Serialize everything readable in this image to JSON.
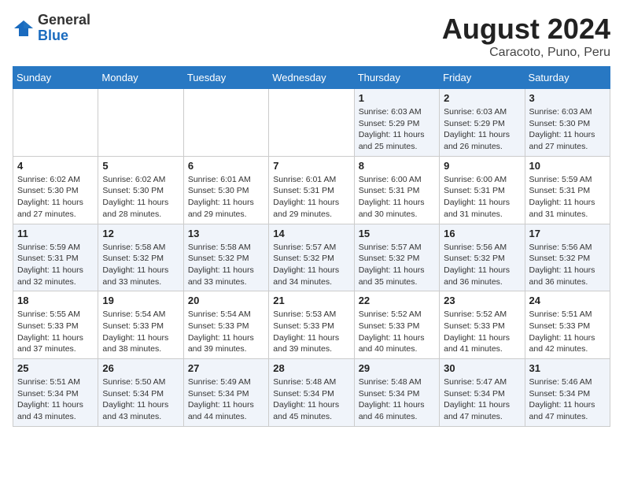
{
  "header": {
    "logo_general": "General",
    "logo_blue": "Blue",
    "title": "August 2024",
    "location": "Caracoto, Puno, Peru"
  },
  "weekdays": [
    "Sunday",
    "Monday",
    "Tuesday",
    "Wednesday",
    "Thursday",
    "Friday",
    "Saturday"
  ],
  "weeks": [
    [
      {
        "day": "",
        "info": ""
      },
      {
        "day": "",
        "info": ""
      },
      {
        "day": "",
        "info": ""
      },
      {
        "day": "",
        "info": ""
      },
      {
        "day": "1",
        "info": "Sunrise: 6:03 AM\nSunset: 5:29 PM\nDaylight: 11 hours and 25 minutes."
      },
      {
        "day": "2",
        "info": "Sunrise: 6:03 AM\nSunset: 5:29 PM\nDaylight: 11 hours and 26 minutes."
      },
      {
        "day": "3",
        "info": "Sunrise: 6:03 AM\nSunset: 5:30 PM\nDaylight: 11 hours and 27 minutes."
      }
    ],
    [
      {
        "day": "4",
        "info": "Sunrise: 6:02 AM\nSunset: 5:30 PM\nDaylight: 11 hours and 27 minutes."
      },
      {
        "day": "5",
        "info": "Sunrise: 6:02 AM\nSunset: 5:30 PM\nDaylight: 11 hours and 28 minutes."
      },
      {
        "day": "6",
        "info": "Sunrise: 6:01 AM\nSunset: 5:30 PM\nDaylight: 11 hours and 29 minutes."
      },
      {
        "day": "7",
        "info": "Sunrise: 6:01 AM\nSunset: 5:31 PM\nDaylight: 11 hours and 29 minutes."
      },
      {
        "day": "8",
        "info": "Sunrise: 6:00 AM\nSunset: 5:31 PM\nDaylight: 11 hours and 30 minutes."
      },
      {
        "day": "9",
        "info": "Sunrise: 6:00 AM\nSunset: 5:31 PM\nDaylight: 11 hours and 31 minutes."
      },
      {
        "day": "10",
        "info": "Sunrise: 5:59 AM\nSunset: 5:31 PM\nDaylight: 11 hours and 31 minutes."
      }
    ],
    [
      {
        "day": "11",
        "info": "Sunrise: 5:59 AM\nSunset: 5:31 PM\nDaylight: 11 hours and 32 minutes."
      },
      {
        "day": "12",
        "info": "Sunrise: 5:58 AM\nSunset: 5:32 PM\nDaylight: 11 hours and 33 minutes."
      },
      {
        "day": "13",
        "info": "Sunrise: 5:58 AM\nSunset: 5:32 PM\nDaylight: 11 hours and 33 minutes."
      },
      {
        "day": "14",
        "info": "Sunrise: 5:57 AM\nSunset: 5:32 PM\nDaylight: 11 hours and 34 minutes."
      },
      {
        "day": "15",
        "info": "Sunrise: 5:57 AM\nSunset: 5:32 PM\nDaylight: 11 hours and 35 minutes."
      },
      {
        "day": "16",
        "info": "Sunrise: 5:56 AM\nSunset: 5:32 PM\nDaylight: 11 hours and 36 minutes."
      },
      {
        "day": "17",
        "info": "Sunrise: 5:56 AM\nSunset: 5:32 PM\nDaylight: 11 hours and 36 minutes."
      }
    ],
    [
      {
        "day": "18",
        "info": "Sunrise: 5:55 AM\nSunset: 5:33 PM\nDaylight: 11 hours and 37 minutes."
      },
      {
        "day": "19",
        "info": "Sunrise: 5:54 AM\nSunset: 5:33 PM\nDaylight: 11 hours and 38 minutes."
      },
      {
        "day": "20",
        "info": "Sunrise: 5:54 AM\nSunset: 5:33 PM\nDaylight: 11 hours and 39 minutes."
      },
      {
        "day": "21",
        "info": "Sunrise: 5:53 AM\nSunset: 5:33 PM\nDaylight: 11 hours and 39 minutes."
      },
      {
        "day": "22",
        "info": "Sunrise: 5:52 AM\nSunset: 5:33 PM\nDaylight: 11 hours and 40 minutes."
      },
      {
        "day": "23",
        "info": "Sunrise: 5:52 AM\nSunset: 5:33 PM\nDaylight: 11 hours and 41 minutes."
      },
      {
        "day": "24",
        "info": "Sunrise: 5:51 AM\nSunset: 5:33 PM\nDaylight: 11 hours and 42 minutes."
      }
    ],
    [
      {
        "day": "25",
        "info": "Sunrise: 5:51 AM\nSunset: 5:34 PM\nDaylight: 11 hours and 43 minutes."
      },
      {
        "day": "26",
        "info": "Sunrise: 5:50 AM\nSunset: 5:34 PM\nDaylight: 11 hours and 43 minutes."
      },
      {
        "day": "27",
        "info": "Sunrise: 5:49 AM\nSunset: 5:34 PM\nDaylight: 11 hours and 44 minutes."
      },
      {
        "day": "28",
        "info": "Sunrise: 5:48 AM\nSunset: 5:34 PM\nDaylight: 11 hours and 45 minutes."
      },
      {
        "day": "29",
        "info": "Sunrise: 5:48 AM\nSunset: 5:34 PM\nDaylight: 11 hours and 46 minutes."
      },
      {
        "day": "30",
        "info": "Sunrise: 5:47 AM\nSunset: 5:34 PM\nDaylight: 11 hours and 47 minutes."
      },
      {
        "day": "31",
        "info": "Sunrise: 5:46 AM\nSunset: 5:34 PM\nDaylight: 11 hours and 47 minutes."
      }
    ]
  ]
}
